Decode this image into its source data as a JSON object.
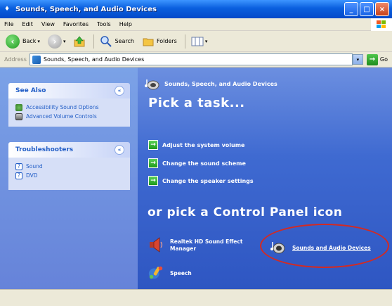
{
  "window": {
    "title": "Sounds, Speech, and Audio Devices"
  },
  "menu": [
    "File",
    "Edit",
    "View",
    "Favorites",
    "Tools",
    "Help"
  ],
  "toolbar": {
    "back_label": "Back",
    "search_label": "Search",
    "folders_label": "Folders"
  },
  "address": {
    "label": "Address",
    "value": "Sounds, Speech, and Audio Devices",
    "go_label": "Go"
  },
  "see_also": {
    "title": "See Also",
    "items": [
      "Accessibility Sound Options",
      "Advanced Volume Controls"
    ]
  },
  "troubleshooters": {
    "title": "Troubleshooters",
    "items": [
      "Sound",
      "DVD"
    ]
  },
  "category": {
    "title": "Sounds, Speech, and Audio Devices"
  },
  "pick_task": {
    "heading": "Pick a task...",
    "tasks": [
      "Adjust the system volume",
      "Change the sound scheme",
      "Change the speaker settings"
    ]
  },
  "control_panel": {
    "heading": "or pick a Control Panel icon",
    "items": [
      "Realtek HD Sound Effect Manager",
      "Sounds and Audio Devices",
      "Speech"
    ]
  },
  "colors": {
    "title_bar": "#0a5fde",
    "pane_bg": "#3f6ad1",
    "highlight": "#d42a22"
  }
}
